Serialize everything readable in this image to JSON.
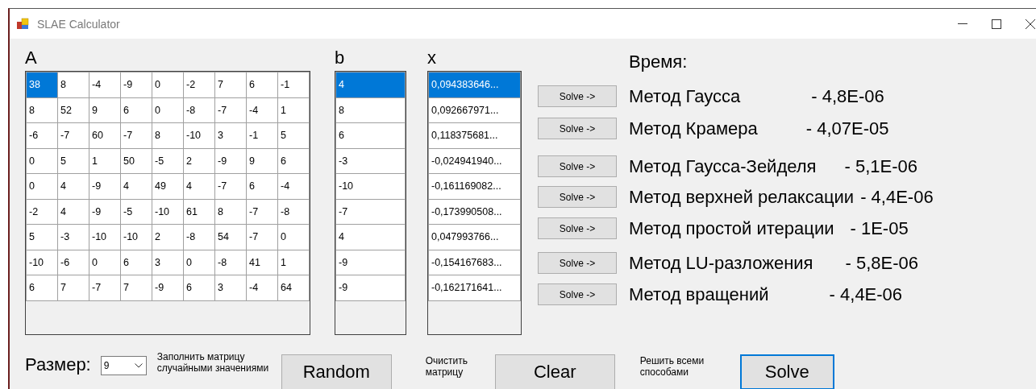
{
  "window": {
    "title": "SLAE Calculator"
  },
  "matrix_a": {
    "label": "A",
    "rows": [
      [
        {
          "value": "38",
          "selected": true
        },
        {
          "value": "8",
          "selected": false
        },
        {
          "value": "-4",
          "selected": false
        },
        {
          "value": "-9",
          "selected": false
        },
        {
          "value": "0",
          "selected": false
        },
        {
          "value": "-2",
          "selected": false
        },
        {
          "value": "7",
          "selected": false
        },
        {
          "value": "6",
          "selected": false
        },
        {
          "value": "-1",
          "selected": false
        }
      ],
      [
        {
          "value": "8",
          "selected": false
        },
        {
          "value": "52",
          "selected": false
        },
        {
          "value": "9",
          "selected": false
        },
        {
          "value": "6",
          "selected": false
        },
        {
          "value": "0",
          "selected": false
        },
        {
          "value": "-8",
          "selected": false
        },
        {
          "value": "-7",
          "selected": false
        },
        {
          "value": "-4",
          "selected": false
        },
        {
          "value": "1",
          "selected": false
        }
      ],
      [
        {
          "value": "-6",
          "selected": false
        },
        {
          "value": "-7",
          "selected": false
        },
        {
          "value": "60",
          "selected": false
        },
        {
          "value": "-7",
          "selected": false
        },
        {
          "value": "8",
          "selected": false
        },
        {
          "value": "-10",
          "selected": false
        },
        {
          "value": "3",
          "selected": false
        },
        {
          "value": "-1",
          "selected": false
        },
        {
          "value": "5",
          "selected": false
        }
      ],
      [
        {
          "value": "0",
          "selected": false
        },
        {
          "value": "5",
          "selected": false
        },
        {
          "value": "1",
          "selected": false
        },
        {
          "value": "50",
          "selected": false
        },
        {
          "value": "-5",
          "selected": false
        },
        {
          "value": "2",
          "selected": false
        },
        {
          "value": "-9",
          "selected": false
        },
        {
          "value": "9",
          "selected": false
        },
        {
          "value": "6",
          "selected": false
        }
      ],
      [
        {
          "value": "0",
          "selected": false
        },
        {
          "value": "4",
          "selected": false
        },
        {
          "value": "-9",
          "selected": false
        },
        {
          "value": "4",
          "selected": false
        },
        {
          "value": "49",
          "selected": false
        },
        {
          "value": "4",
          "selected": false
        },
        {
          "value": "-7",
          "selected": false
        },
        {
          "value": "6",
          "selected": false
        },
        {
          "value": "-4",
          "selected": false
        }
      ],
      [
        {
          "value": "-2",
          "selected": false
        },
        {
          "value": "4",
          "selected": false
        },
        {
          "value": "-9",
          "selected": false
        },
        {
          "value": "-5",
          "selected": false
        },
        {
          "value": "-10",
          "selected": false
        },
        {
          "value": "61",
          "selected": false
        },
        {
          "value": "8",
          "selected": false
        },
        {
          "value": "-7",
          "selected": false
        },
        {
          "value": "-8",
          "selected": false
        }
      ],
      [
        {
          "value": "5",
          "selected": false
        },
        {
          "value": "-3",
          "selected": false
        },
        {
          "value": "-10",
          "selected": false
        },
        {
          "value": "-10",
          "selected": false
        },
        {
          "value": "2",
          "selected": false
        },
        {
          "value": "-8",
          "selected": false
        },
        {
          "value": "54",
          "selected": false
        },
        {
          "value": "-7",
          "selected": false
        },
        {
          "value": "0",
          "selected": false
        }
      ],
      [
        {
          "value": "-10",
          "selected": false
        },
        {
          "value": "-6",
          "selected": false
        },
        {
          "value": "0",
          "selected": false
        },
        {
          "value": "6",
          "selected": false
        },
        {
          "value": "3",
          "selected": false
        },
        {
          "value": "0",
          "selected": false
        },
        {
          "value": "-8",
          "selected": false
        },
        {
          "value": "41",
          "selected": false
        },
        {
          "value": "1",
          "selected": false
        }
      ],
      [
        {
          "value": "6",
          "selected": false
        },
        {
          "value": "7",
          "selected": false
        },
        {
          "value": "-7",
          "selected": false
        },
        {
          "value": "7",
          "selected": false
        },
        {
          "value": "-9",
          "selected": false
        },
        {
          "value": "6",
          "selected": false
        },
        {
          "value": "3",
          "selected": false
        },
        {
          "value": "-4",
          "selected": false
        },
        {
          "value": "64",
          "selected": false
        }
      ]
    ]
  },
  "vector_b": {
    "label": "b",
    "rows": [
      [
        {
          "value": "4",
          "selected": true
        }
      ],
      [
        {
          "value": "8",
          "selected": false
        }
      ],
      [
        {
          "value": "6",
          "selected": false
        }
      ],
      [
        {
          "value": "-3",
          "selected": false
        }
      ],
      [
        {
          "value": "-10",
          "selected": false
        }
      ],
      [
        {
          "value": "-7",
          "selected": false
        }
      ],
      [
        {
          "value": "4",
          "selected": false
        }
      ],
      [
        {
          "value": "-9",
          "selected": false
        }
      ],
      [
        {
          "value": "-9",
          "selected": false
        }
      ]
    ]
  },
  "vector_x": {
    "label": "x",
    "rows": [
      [
        {
          "value": "0,094383646...",
          "selected": true
        }
      ],
      [
        {
          "value": "0,092667971...",
          "selected": false
        }
      ],
      [
        {
          "value": "0,118375681...",
          "selected": false
        }
      ],
      [
        {
          "value": "-0,024941940...",
          "selected": false
        }
      ],
      [
        {
          "value": "-0,161169082...",
          "selected": false
        }
      ],
      [
        {
          "value": "-0,173990508...",
          "selected": false
        }
      ],
      [
        {
          "value": "0,047993766...",
          "selected": false
        }
      ],
      [
        {
          "value": "-0,154167683...",
          "selected": false
        }
      ],
      [
        {
          "value": "-0,162171641...",
          "selected": false
        }
      ]
    ]
  },
  "time_label": "Время:",
  "methods": [
    {
      "button": "Solve ->",
      "name": "Метод Гаусса",
      "time": "- 4,8E-06"
    },
    {
      "button": "Solve ->",
      "name": "Метод Крамера",
      "time": "- 4,07E-05"
    },
    {
      "button": "Solve ->",
      "name": "Метод Гаусса-Зейделя",
      "time": "- 5,1E-06"
    },
    {
      "button": "Solve ->",
      "name": "Метод верхней релаксации",
      "time": "- 4,4E-06"
    },
    {
      "button": "Solve ->",
      "name": "Метод простой итерации",
      "time": "- 1E-05"
    },
    {
      "button": "Solve ->",
      "name": "Метод LU-разложения",
      "time": "- 5,8E-06"
    },
    {
      "button": "Solve ->",
      "name": "Метод вращений",
      "time": "- 4,4E-06"
    }
  ],
  "bottom": {
    "size_label": "Размер:",
    "size_value": "9",
    "random_hint": "Заполнить матрицу случайными значениями",
    "random_button": "Random",
    "clear_hint": "Очистить матрицу",
    "clear_button": "Clear",
    "solve_hint": "Решить всеми способами",
    "solve_button": "Solve"
  }
}
